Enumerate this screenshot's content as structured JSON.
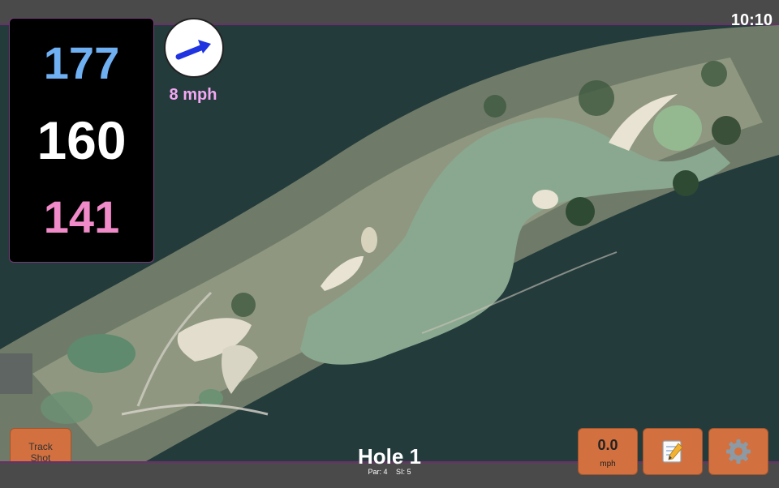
{
  "status": {
    "clock": "10:10"
  },
  "distances": {
    "back": "177",
    "middle": "160",
    "front": "141"
  },
  "wind": {
    "speed_label": "8 mph",
    "direction_icon": "arrow-icon"
  },
  "controls": {
    "track_shot_line1": "Track",
    "track_shot_line2": "Shot",
    "speed_value": "0.0",
    "speed_unit": "mph",
    "notes_icon": "notepad-icon",
    "settings_icon": "gear-icon"
  },
  "hole": {
    "title": "Hole 1",
    "par": "Par: 4",
    "si": "SI: 5"
  },
  "colors": {
    "back_distance": "#6fb0f2",
    "middle_distance": "#ffffff",
    "front_distance": "#f08ac8",
    "wind_text": "#f3a8f3",
    "button": "#d2703f",
    "accent_border": "#6b2f6b"
  }
}
